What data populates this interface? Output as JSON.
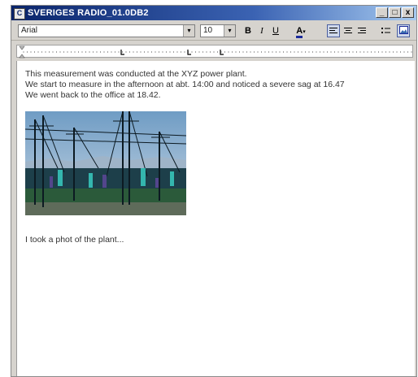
{
  "window": {
    "title": "SVERIGES RADIO_01.0DB2",
    "app_icon": "document-app-icon",
    "controls": {
      "minimize": "_",
      "maximize": "□",
      "close": "x"
    }
  },
  "toolbar": {
    "font": "Arial",
    "size": "10",
    "bold": "B",
    "italic": "I",
    "underline": "U",
    "font_color_icon": "A",
    "align_left_icon": "align-left-icon",
    "align_center_icon": "align-center-icon",
    "align_right_icon": "align-right-icon",
    "bullets_icon": "bullet-list-icon",
    "image_icon": "insert-image-icon",
    "dropdown_arrow": "▾"
  },
  "document": {
    "lines": [
      "This measurement was conducted at the XYZ power plant.",
      "We start to measure in the afternoon at abt. 14:00 and noticed a severe sag at 16.47",
      "We went back to the office at 18.42."
    ],
    "caption": "I took a phot of the plant..."
  },
  "colors": {
    "title_bar": "#0a246a",
    "chrome": "#d6d3ce",
    "font_color_underline": "#1a2a9a"
  }
}
